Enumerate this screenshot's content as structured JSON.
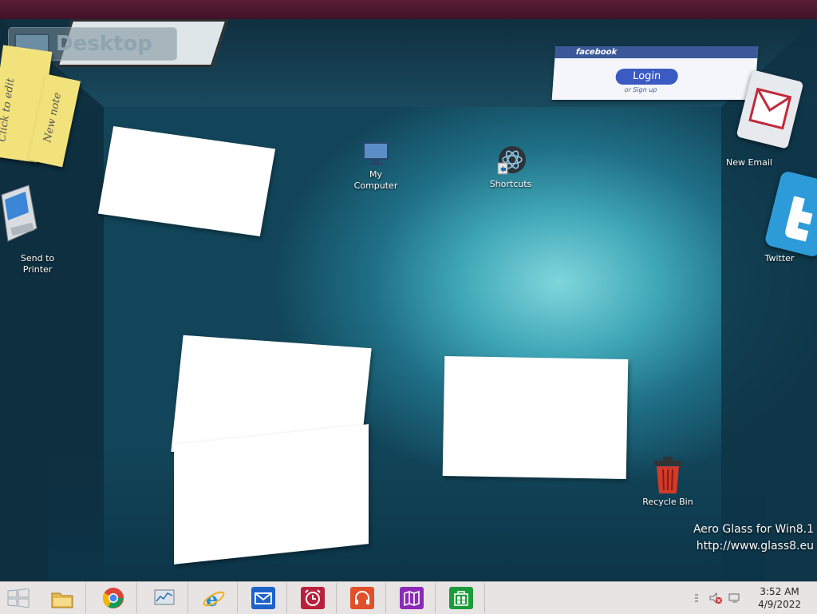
{
  "desktop_label": "Desktop",
  "notes": [
    {
      "text": "Click to edit"
    },
    {
      "text": "New note"
    }
  ],
  "facebook": {
    "brand": "facebook",
    "login_label": "Login",
    "or_text": "or",
    "signup_label": "Sign up"
  },
  "icons": {
    "my_computer": {
      "label_line1": "My",
      "label_line2": "Computer"
    },
    "shortcuts": {
      "label": "Shortcuts"
    },
    "send_to_printer": {
      "label_line1": "Send to",
      "label_line2": "Printer"
    },
    "new_email": {
      "label": "New Email"
    },
    "twitter": {
      "label": "Twitter"
    },
    "recycle_bin": {
      "label": "Recycle Bin"
    }
  },
  "watermark": {
    "line1": "Aero Glass for Win8.1",
    "line2": "http://www.glass8.eu"
  },
  "taskbar": {
    "apps": [
      {
        "name": "File Explorer",
        "icon": "folder-icon",
        "color": "#e8b84a"
      },
      {
        "name": "Google Chrome",
        "icon": "chrome-icon",
        "color": "#db4437"
      },
      {
        "name": "Resource Monitor",
        "icon": "monitor-icon",
        "color": "#7a8fa6"
      },
      {
        "name": "Internet Explorer",
        "icon": "ie-icon",
        "color": "#1e8fd8"
      },
      {
        "name": "Mail",
        "icon": "mail-icon",
        "color": "#1d63c9"
      },
      {
        "name": "Alarms",
        "icon": "alarm-icon",
        "color": "#b8213d"
      },
      {
        "name": "Music",
        "icon": "headphones-icon",
        "color": "#e0502a"
      },
      {
        "name": "Maps",
        "icon": "map-icon",
        "color": "#8b2ab8"
      },
      {
        "name": "Store",
        "icon": "store-icon",
        "color": "#1c9b3a"
      }
    ],
    "clock": {
      "time": "3:52 AM",
      "date": "4/9/2022"
    }
  },
  "colors": {
    "taskbar_bg": "#e8e4e4",
    "top_bar": "#4a1630",
    "room_glow": "#7fd6dc"
  }
}
